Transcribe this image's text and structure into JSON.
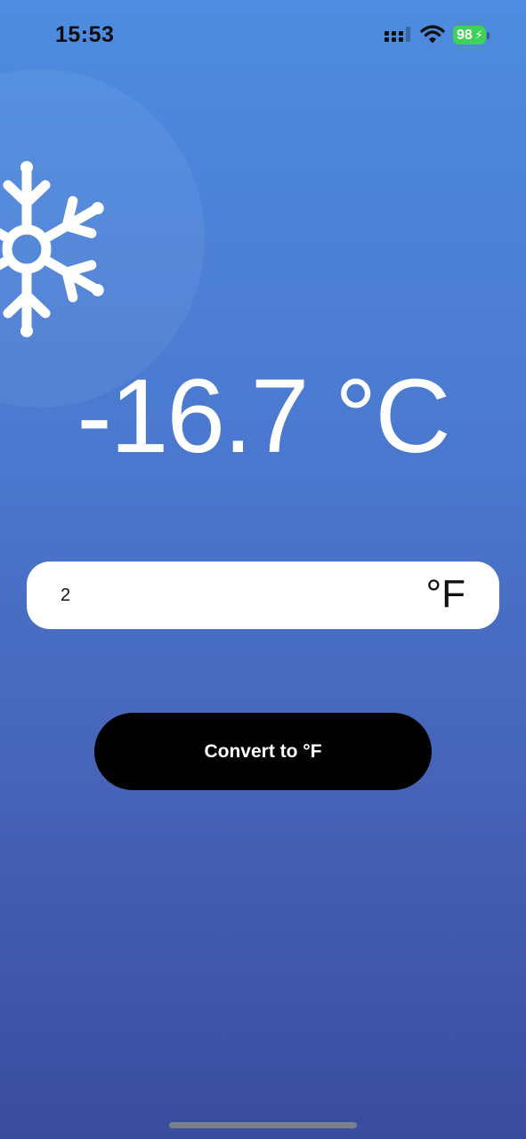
{
  "status_bar": {
    "time": "15:53",
    "battery_level": "98",
    "battery_color": "#3fd25b",
    "icons": [
      "cellular-signal-icon",
      "wifi-icon",
      "battery-charging-icon"
    ]
  },
  "main": {
    "weather_icon": "snowflake-icon",
    "result_text": "-16.7 °C",
    "input": {
      "value": "2",
      "placeholder": "",
      "unit_label": "°F"
    },
    "convert_button_label": "Convert to °F"
  },
  "colors": {
    "background_top": "#4d8ce0",
    "background_bottom": "#3a4c9e",
    "button": "#000000",
    "text_light": "#ffffff"
  }
}
